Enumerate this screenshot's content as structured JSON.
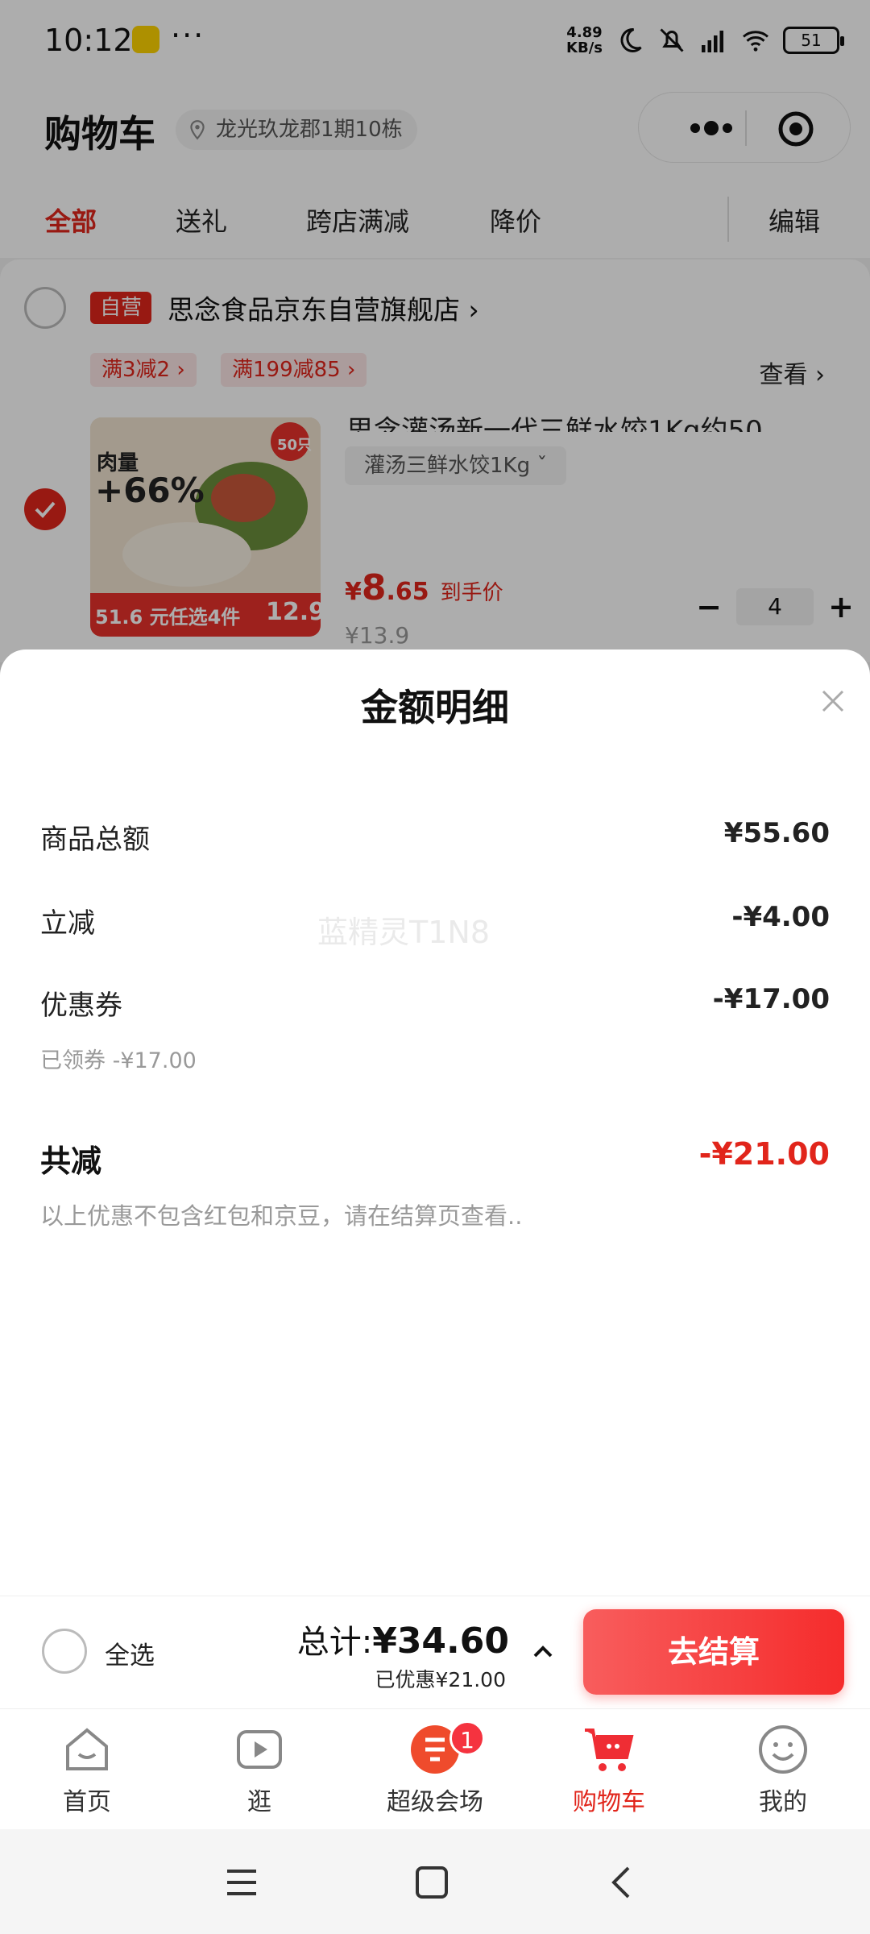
{
  "status_bar": {
    "time": "10:12",
    "dots": "···",
    "net_speed": "4.89",
    "net_unit": "KB/s",
    "battery": "51"
  },
  "header": {
    "title": "购物车",
    "location": "龙光玖龙郡1期10栋"
  },
  "filter_tabs": {
    "all": "全部",
    "gift": "送礼",
    "cross_store": "跨店满减",
    "price_drop": "降价",
    "edit": "编辑"
  },
  "shop": {
    "tag": "自营",
    "name": "思念食品京东自营旗舰店 ›",
    "promos": [
      "满3减2 ›",
      "满199减85 ›"
    ],
    "view": "查看 ›"
  },
  "product": {
    "name_cut": "思念灌汤新一代三鲜水饺1Kg约50",
    "spec": "灌汤三鲜水饺1Kg  ˇ",
    "price_symbol": "¥",
    "price_int": "8",
    "price_dec": ".65",
    "price_note": "到手价",
    "original_price": "¥13.9",
    "quantity": "4",
    "thumb_text_1": "肉量",
    "thumb_text_2": "+66%",
    "thumb_text_3": "51.6 元任选4件",
    "thumb_text_4": "12.9",
    "thumb_badge": "50只"
  },
  "sheet": {
    "title": "金额明细",
    "rows": [
      {
        "label": "商品总额",
        "value": "¥55.60"
      },
      {
        "label": "立减",
        "value": "-¥4.00"
      },
      {
        "label": "优惠券",
        "value": "-¥17.00",
        "sub": "已领券 -¥17.00"
      }
    ],
    "total_label": "共减",
    "total_value": "-¥21.00",
    "disclaimer": "以上优惠不包含红包和京豆，请在结算页查看..",
    "watermark": "蓝精灵T1N8"
  },
  "settle": {
    "select_all": "全选",
    "total_prefix": "总计:",
    "total_value": "¥34.60",
    "discount": "已优惠¥21.00",
    "checkout": "去结算"
  },
  "tabbar": {
    "home": "首页",
    "browse": "逛",
    "venue": "超级会场",
    "venue_badge": "1",
    "cart": "购物车",
    "mine": "我的"
  },
  "colors": {
    "accent": "#e1251b",
    "checkout": "#f52c2c"
  }
}
